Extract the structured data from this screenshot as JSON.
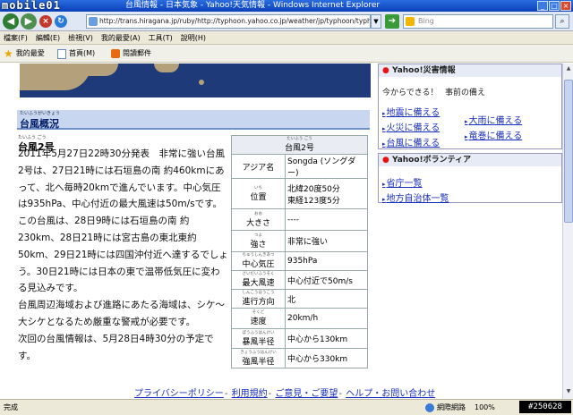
{
  "window": {
    "logo": "mobile01",
    "title": "台風情報 - 日本気象 - Yahoo!天気情報 - Windows Internet Explorer"
  },
  "address": {
    "url": "http://trans.hiragana.jp/ruby/http://typhoon.yahoo.co.jp/weather/jp/typhoon/typha.html",
    "search_placeholder": "Bing"
  },
  "menu": [
    "檔案(F)",
    "編輯(E)",
    "檢視(V)",
    "我的最愛(A)",
    "工具(T)",
    "說明(H)"
  ],
  "favorites": {
    "label": "我的最愛",
    "items": [
      "首頁(M)",
      "閱讀郵件"
    ]
  },
  "main": {
    "section_ruby": "たいふうがいきょう",
    "section_title": "台風概況",
    "typhoon_ruby": "たいふう ごう",
    "typhoon_name": "台風2号",
    "paragraphs": [
      "2011年5月27日22時30分発表　非常に強い台風2号は、27日21時には石垣島の南 約460kmにあって、北へ毎時20kmで進んでいます。中心気圧は935hPa、中心付近の最大風速は50m/sです。この台風は、28日9時には石垣島の南 約230km、28日21時には宮古島の東北東約50km、29日21時には四国沖付近へ達するでしょう。30日21時には日本の東で温帯低気圧に変わる見込みです。",
      "台風周辺海域および進路にあたる海域は、シケ～大シケとなるため厳重な警戒が必要です。",
      "次回の台風情報は、5月28日4時30分の予定です。"
    ]
  },
  "table": {
    "header_ruby": "たいふう ごう",
    "header": "台風2号",
    "rows": [
      {
        "label": "アジア名",
        "ruby": "",
        "value": "Songda (ソングダー)"
      },
      {
        "label": "位置",
        "ruby": "いち",
        "value": "北緯20度50分\n東経123度5分"
      },
      {
        "label": "大きさ",
        "ruby": "おお",
        "value": "----"
      },
      {
        "label": "強さ",
        "ruby": "つよ",
        "value": "非常に強い"
      },
      {
        "label": "中心気圧",
        "ruby": "ちゅうしんきあつ",
        "value": "935hPa"
      },
      {
        "label": "最大風速",
        "ruby": "さいだいふうそく",
        "value": "中心付近で50m/s"
      },
      {
        "label": "進行方向",
        "ruby": "しんこうほうこう",
        "value": "北"
      },
      {
        "label": "速度",
        "ruby": "そくど",
        "value": "20km/h"
      },
      {
        "label": "暴風半径",
        "ruby": "ぼうふうはんけい",
        "value": "中心から130km"
      },
      {
        "label": "強風半径",
        "ruby": "きょうふうはんけい",
        "value": "中心から330km"
      }
    ]
  },
  "sidebar": {
    "disaster_title": "Yahoo!災害情報",
    "disaster_tagline_1": "今からできる！",
    "disaster_tagline_2": "事前の備え",
    "disaster_links": [
      "地震に備える",
      "火災に備える",
      "台風に備える",
      "大雨に備える",
      "竜巻に備える"
    ],
    "volunteer_title": "Yahoo!ボランティア",
    "volunteer_links": [
      "省庁一覧",
      "地方自治体一覧"
    ]
  },
  "footer": {
    "links": [
      "プライバシーポリシー",
      "利用規約",
      "ご意見・ご要望",
      "ヘルプ・お問い合わせ"
    ]
  },
  "status": {
    "text": "完成",
    "zone": "網際網路",
    "zoom": "100%",
    "watermark": "#250628"
  }
}
